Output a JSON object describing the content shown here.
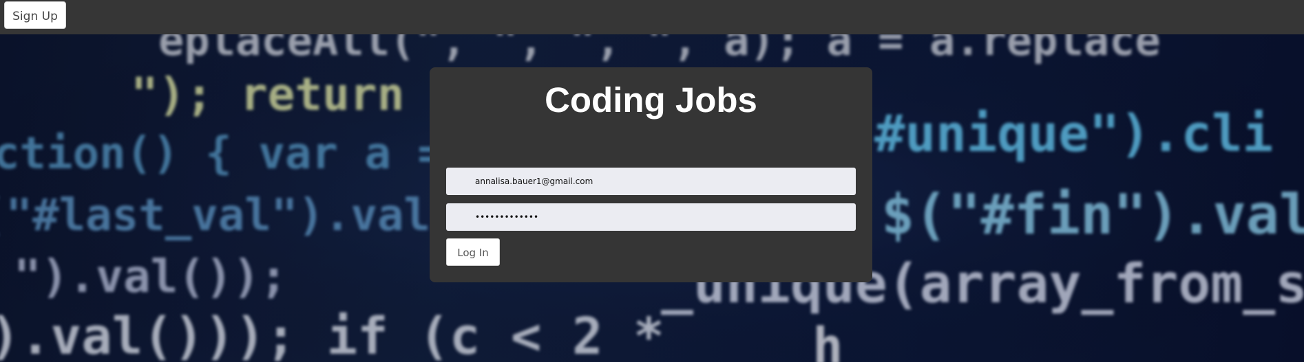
{
  "nav": {
    "signup_label": "Sign Up"
  },
  "login_card": {
    "title": "Coding Jobs",
    "email_value": "annalisa.bauer1@gmail.com",
    "password_value": "•••••••••••••",
    "login_label": "Log In"
  },
  "background": {
    "code_snippets": [
      "\"); return a.",
      "eplaceAll(\", \", \", \", a); a = a.replace",
      "ction() { var a = a",
      "#unique\").cli",
      "\").val());",
      "$(\"#fin\").val",
      "(\"#last_val\").val()",
      "_unique(array_from_s",
      "\").val())); if (c < 2 *",
      "h"
    ]
  },
  "colors": {
    "topbar": "#363636",
    "card": "#353535",
    "input_bg": "#ebecf2"
  }
}
